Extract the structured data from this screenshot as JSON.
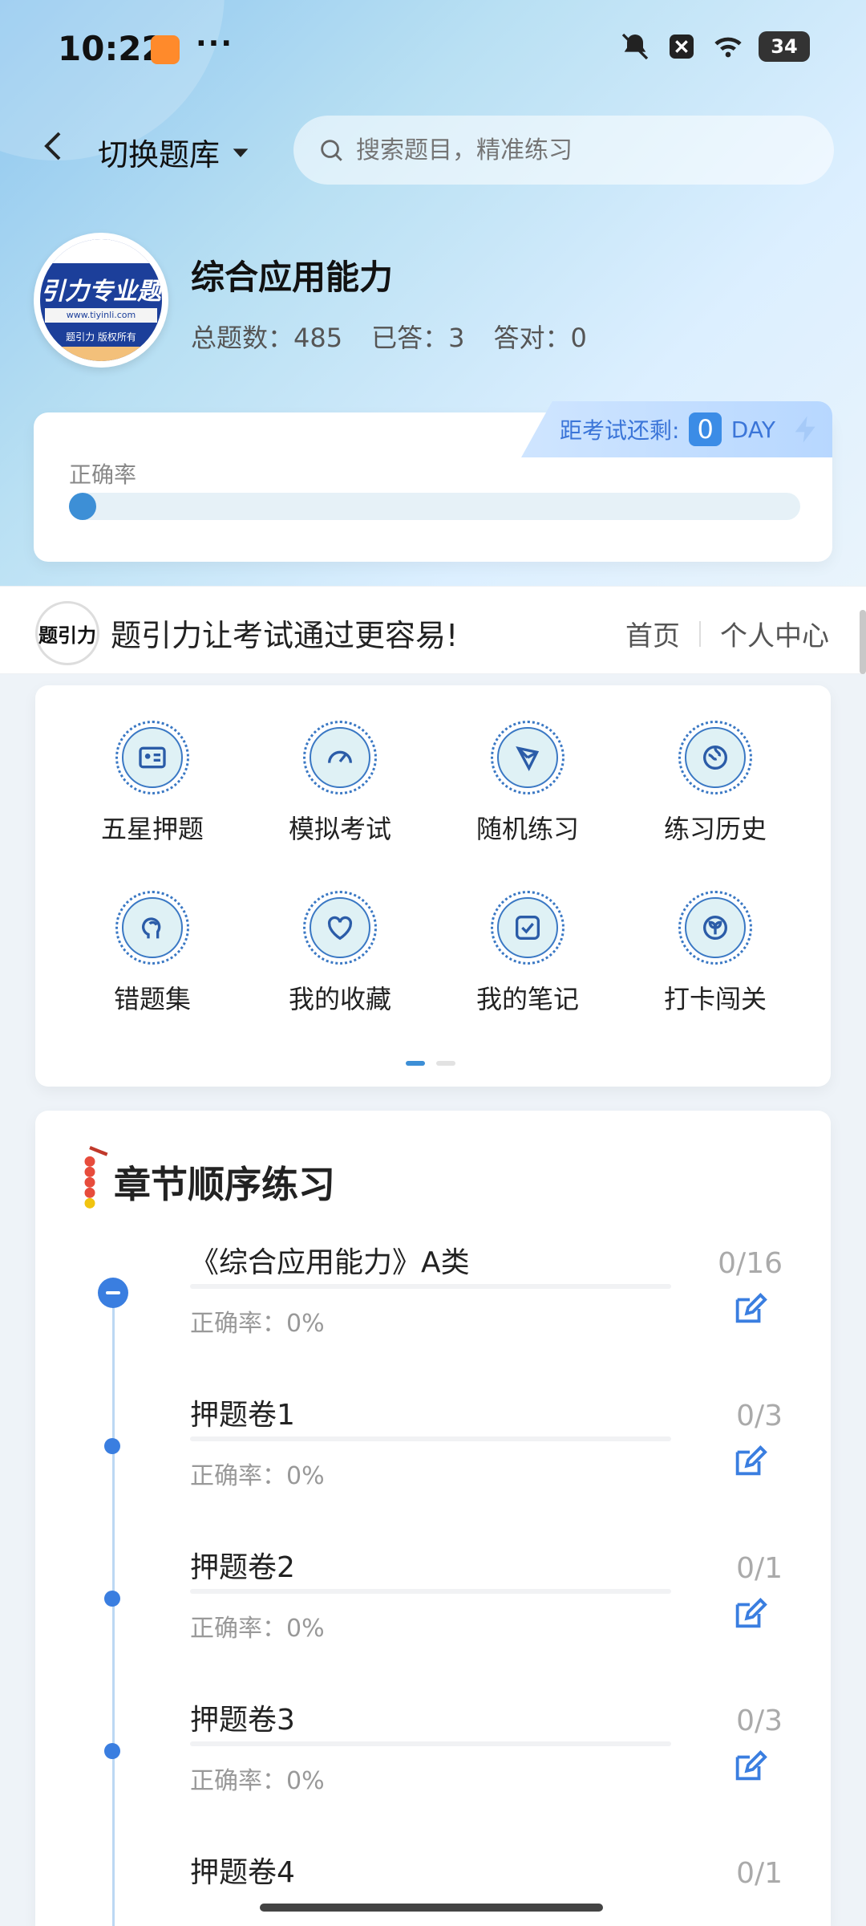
{
  "status_bar": {
    "time": "10:22",
    "more": "···",
    "battery": "34"
  },
  "nav": {
    "switch_label": "切换题库",
    "search_placeholder": "搜索题目，精准练习"
  },
  "bank": {
    "title": "综合应用能力",
    "stats": [
      {
        "label": "总题数：485"
      },
      {
        "label": "已答：3"
      },
      {
        "label": "答对：0"
      }
    ],
    "logo": {
      "main_text": "引力专业题",
      "url_text": "www.tiyinli.com",
      "copyright_text": "题引力 版权所有"
    }
  },
  "accuracy": {
    "label": "正确率",
    "value_percent": 0,
    "countdown_label": "距考试还剩:",
    "countdown_value": "0",
    "countdown_unit": "DAY"
  },
  "promo": {
    "logo_text": "题引力",
    "text": "题引力让考试通过更容易!",
    "links": [
      "首页",
      "个人中心"
    ]
  },
  "grid": {
    "items": [
      {
        "label": "五星押题",
        "icon": "id-card-icon"
      },
      {
        "label": "模拟考试",
        "icon": "gauge-icon"
      },
      {
        "label": "随机练习",
        "icon": "network-icon"
      },
      {
        "label": "练习历史",
        "icon": "globe-icon"
      },
      {
        "label": "错题集",
        "icon": "head-icon"
      },
      {
        "label": "我的收藏",
        "icon": "heart-icon"
      },
      {
        "label": "我的笔记",
        "icon": "note-check-icon"
      },
      {
        "label": "打卡闯关",
        "icon": "sprout-icon"
      }
    ],
    "active_page": 1,
    "page_count": 2
  },
  "chapters": {
    "title": "章节顺序练习",
    "items": [
      {
        "name": "《综合应用能力》A类",
        "rate": "正确率：0%",
        "count": "0/16"
      },
      {
        "name": "押题卷1",
        "rate": "正确率：0%",
        "count": "0/3"
      },
      {
        "name": "押题卷2",
        "rate": "正确率：0%",
        "count": "0/1"
      },
      {
        "name": "押题卷3",
        "rate": "正确率：0%",
        "count": "0/3"
      },
      {
        "name": "押题卷4",
        "rate": "",
        "count": "0/1"
      }
    ]
  },
  "colors": {
    "accent": "#3a7ee0",
    "hero_start": "#8ec6ef",
    "hero_end": "#eaf4fb"
  }
}
